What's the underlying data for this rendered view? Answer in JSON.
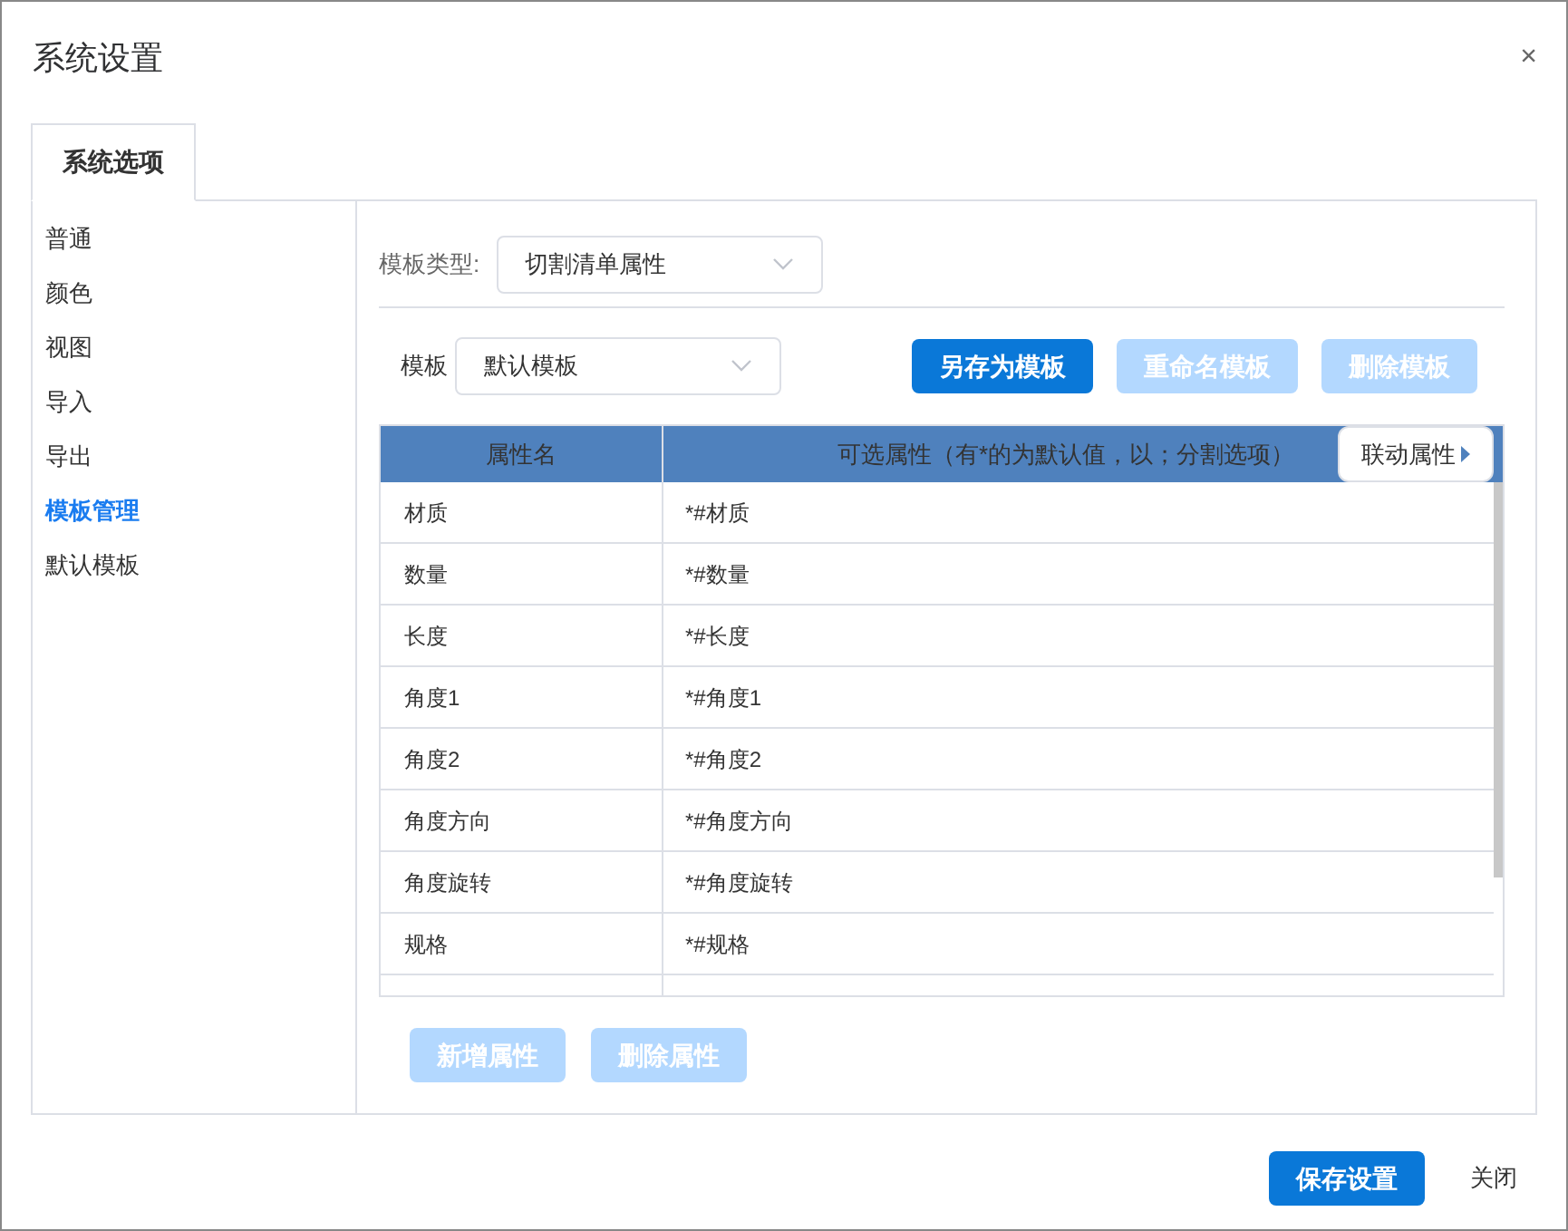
{
  "window": {
    "title": "系统设置",
    "close": "×"
  },
  "tabs": [
    {
      "label": "系统选项",
      "selected": true
    }
  ],
  "sidebar": {
    "items": [
      {
        "label": "普通",
        "selected": false
      },
      {
        "label": "颜色",
        "selected": false
      },
      {
        "label": "视图",
        "selected": false
      },
      {
        "label": "导入",
        "selected": false
      },
      {
        "label": "导出",
        "selected": false
      },
      {
        "label": "模板管理",
        "selected": true
      },
      {
        "label": "默认模板",
        "selected": false
      }
    ]
  },
  "template_type": {
    "label": "模板类型:",
    "value": "切割清单属性"
  },
  "template": {
    "label": "模板",
    "value": "默认模板"
  },
  "template_buttons": [
    {
      "label": "另存为模板",
      "disabled": false
    },
    {
      "label": "重命名模板",
      "disabled": true
    },
    {
      "label": "删除模板",
      "disabled": true
    }
  ],
  "table": {
    "columns": [
      "属性名",
      "可选属性（有*的为默认值，以；分割选项）"
    ],
    "linked_button": "联动属性",
    "rows": [
      [
        "材质",
        "*#材质"
      ],
      [
        "数量",
        "*#数量"
      ],
      [
        "长度",
        "*#长度"
      ],
      [
        "角度1",
        "*#角度1"
      ],
      [
        "角度2",
        "*#角度2"
      ],
      [
        "角度方向",
        "*#角度方向"
      ],
      [
        "角度旋转",
        "*#角度旋转"
      ],
      [
        "规格",
        "*#规格"
      ]
    ]
  },
  "table_buttons": [
    {
      "label": "新增属性",
      "disabled": true
    },
    {
      "label": "删除属性",
      "disabled": true
    }
  ],
  "footer": {
    "save": "保存设置",
    "close": "关闭"
  }
}
